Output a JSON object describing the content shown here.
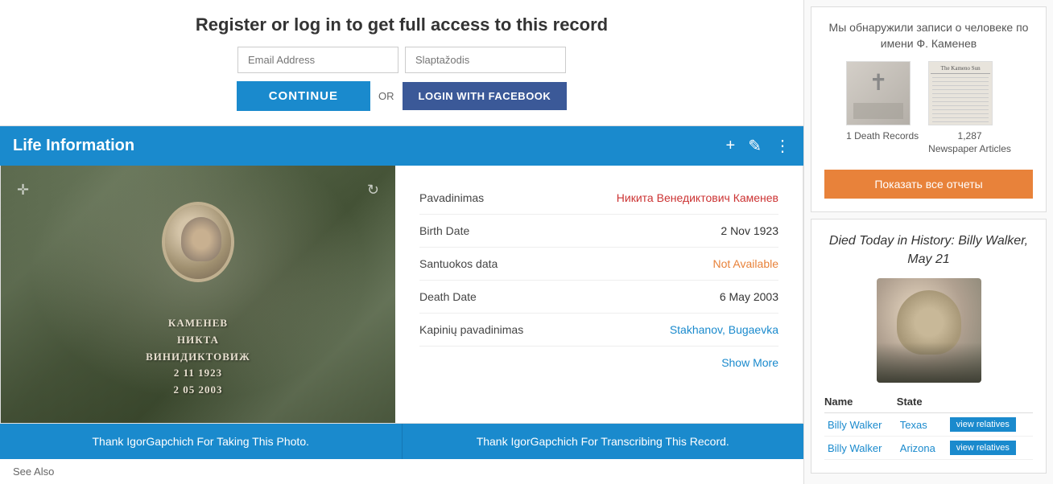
{
  "register": {
    "title": "Register or log in to get full access to this record",
    "email_placeholder": "Email Address",
    "password_placeholder": "Slaptažodis",
    "continue_label": "CONTINUE",
    "or_text": "OR",
    "facebook_label": "LOGIN WITH FACEBOOK"
  },
  "life_info": {
    "section_title": "Life Information",
    "fields": [
      {
        "label": "Pavadinimas",
        "value": "Никита Венедиктович Каменев",
        "value_class": "red"
      },
      {
        "label": "Birth Date",
        "value": "2 Nov 1923",
        "value_class": ""
      },
      {
        "label": "Santuokos data",
        "value": "Not Available",
        "value_class": "orange"
      },
      {
        "label": "Death Date",
        "value": "6 May 2003",
        "value_class": ""
      },
      {
        "label": "Kapinių pavadinimas",
        "value": "Stakhanov, Bugaevka",
        "value_class": "blue"
      }
    ],
    "show_more": "Show More",
    "grave_text": "КАМЕНЕВ\nНИКТА\nВИНИДИКТОВИЧ\n2 11 1923\n2 05 2003"
  },
  "thank_buttons": {
    "photo": "Thank IgorGapchich For Taking This Photo.",
    "transcribe": "Thank IgorGapchich For Transcribing This Record."
  },
  "see_also": "See Also",
  "sidebar": {
    "records_title": "Мы обнаружили записи о человеке по имени Ф. Каменев",
    "death_record": {
      "count": "1 Death",
      "label": "Records"
    },
    "newspaper": {
      "count": "1,287",
      "label": "Newspaper Articles"
    },
    "show_all_btn": "Показать все отчеты",
    "died_today_title": "Died Today in History: Billy Walker, May 21",
    "relatives_headers": {
      "name": "Name",
      "state": "State"
    },
    "relatives": [
      {
        "name": "Billy Walker",
        "state": "Texas",
        "view_label": "view relatives"
      },
      {
        "name": "Billy Walker",
        "state": "Arizona",
        "view_label": "view relatives"
      }
    ]
  }
}
